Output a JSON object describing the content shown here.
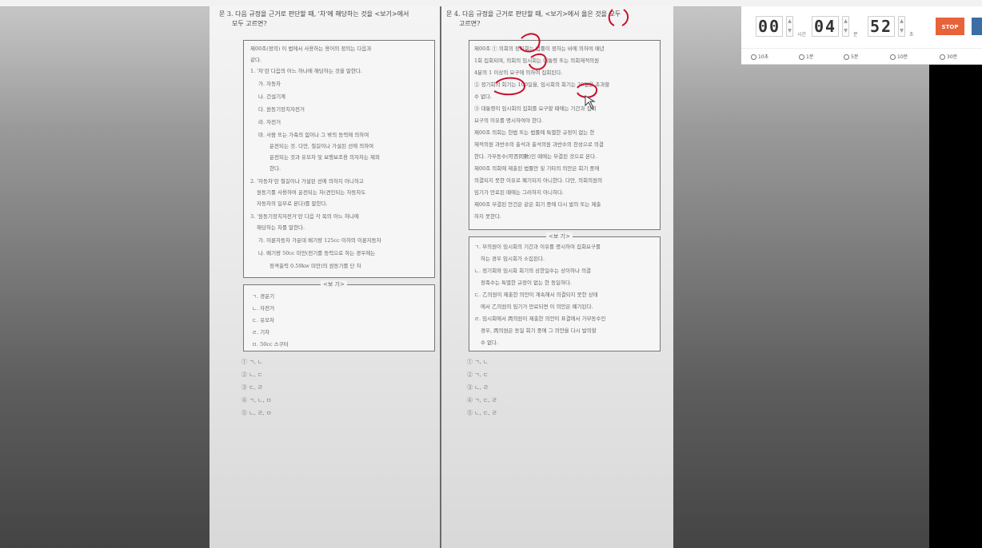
{
  "timer": {
    "hours": "00",
    "hours_unit": "시간",
    "minutes": "04",
    "minutes_unit": "분",
    "seconds": "52",
    "seconds_unit": "초",
    "stop_label": "STOP",
    "presets": [
      "10초",
      "1분",
      "5분",
      "10분",
      "30분"
    ]
  },
  "left_question": {
    "head1": "문 3. 다음 규정을 근거로 판단할 때, '차'에 해당하는 것을 <보기>에서",
    "head2": "모두 고르면?",
    "box_lines": [
      "제00조(정의) 이 법에서 사용하는 용어의 정의는 다음과",
      "같다.",
      "1. '차'란 다음의 어느 하나에 해당하는 것을 말한다.",
      "가. 자동차",
      "나. 건설기계",
      "다. 원동기장치자전거",
      "라. 자전거",
      "마. 사람 또는 가축의 힘이나 그 밖의 동력에 의하여",
      "운전되는 것. 다만, 철길이나 가설된 선에 의하여",
      "운전되는 것과 유모차 및 보행보조용 의자차는 제외",
      "한다.",
      "2. '자동차'란 철길이나 가설된 선에 의하지 아니하고",
      "원동기를 사용하여 운전되는 차(견인되는 자동차도",
      "자동차의 일부로 본다)를 말한다.",
      "3. '원동기장치자전거'란 다음 각 목의 어느 하나에",
      "해당하는 차를 말한다.",
      "가. 이륜자동차 가운데 배기량 125cc 이하의 이륜자동차",
      "나. 배기량 50cc 미만(전기를 동력으로 하는 경우에는",
      "정격출력 0.59kw 미만)의 원동기를 단 차"
    ],
    "bogi_title": "<보 기>",
    "bogi_items": [
      "ㄱ. 경운기",
      "ㄴ. 자전거",
      "ㄷ. 유모차",
      "ㄹ. 기차",
      "ㅁ. 50cc 스쿠터"
    ],
    "choices": [
      "① ㄱ, ㄴ",
      "② ㄴ, ㄷ",
      "③ ㄷ, ㄹ",
      "④ ㄱ, ㄴ, ㅁ",
      "⑤ ㄴ, ㄹ, ㅁ"
    ]
  },
  "right_question": {
    "head1": "문 4. 다음 규정을 근거로 판단할 때, <보기>에서 옳은 것을 모두",
    "head2": "고르면?",
    "box_lines": [
      "제00조 ① 의회의 정기회는 법률이 정하는 바에 의하여 매년",
      "1회 집회되며, 의회의 임시회는 대통령 또는 의회재적의원",
      "4분의 1 이상의 요구에 의하여 집회된다.",
      "② 정기회의 회기는 100일을, 임시회의 회기는 30일을 초과할",
      "수 없다.",
      "③ 대통령이 임시회의 집회를 요구할 때에는 기간과 집회",
      "요구의 이유를 명시하여야 한다.",
      "제00조 의회는 헌법 또는 법률에 특별한 규정이 없는 한",
      "재적의원 과반수의 출석과 출석의원 과반수의 찬성으로 의결",
      "한다. 가부동수(可否同數)인 때에는 부결된 것으로 본다.",
      "제00조 의회에 제출된 법률안 및 기타의 의안은 회기 중에",
      "의결되지 못한 이유로 폐기되지 아니한다. 다만, 의회의원의",
      "임기가 만료된 때에는 그러하지 아니하다.",
      "제00조 부결된 안건은 같은 회기 중에 다시 발의 또는 제출",
      "하지 못한다."
    ],
    "bogi_title": "<보 기>",
    "bogi_items": [
      "ㄱ. 부의원이 임시회의 기간과 이유를 명시하여 집회요구를",
      "하는 경우 임시회가 소집된다.",
      "ㄴ. 정기회와 임시회 회기의 상한일수는 상이하나 의결",
      "정족수는 특별한 규정이 없는 한 동일하다.",
      "ㄷ. 乙의원이 제출한 의안이 계속해서 의결되지 못한 상태",
      "에서 乙의원의 임기가 만료되면 이 의안은 폐기된다.",
      "ㄹ. 임시회에서 丙의원이 제출한 의안이 표결에서 가부동수인",
      "경우, 丙의원은 동일 회기 중에 그 의안을 다시 발의할",
      "수 없다."
    ],
    "choices": [
      "① ㄱ, ㄴ",
      "② ㄱ, ㄷ",
      "③ ㄴ, ㄹ",
      "④ ㄱ, ㄷ, ㄹ",
      "⑤ ㄴ, ㄷ, ㄹ"
    ]
  },
  "colors": {
    "annotation": "#c8102e",
    "stop": "#e8623a"
  }
}
